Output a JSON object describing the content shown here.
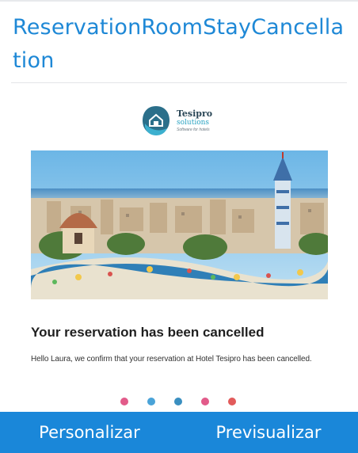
{
  "page": {
    "title": "ReservationRoomStayCancellation"
  },
  "email": {
    "logo": {
      "name": "Tesipro",
      "subname": "solutions",
      "tagline": "Software for hotels"
    },
    "heading": "Your reservation has been cancelled",
    "body": "Hello Laura, we confirm that your reservation at Hotel Tesipro has been cancelled.",
    "social_icons": [
      "facebook-icon",
      "twitter-icon",
      "linkedin-icon",
      "instagram-icon",
      "youtube-icon"
    ]
  },
  "bottom_bar": {
    "customize_label": "Personalizar",
    "preview_label": "Previsualizar"
  },
  "colors": {
    "accent": "#1a87d9",
    "title": "#1e88d6"
  }
}
